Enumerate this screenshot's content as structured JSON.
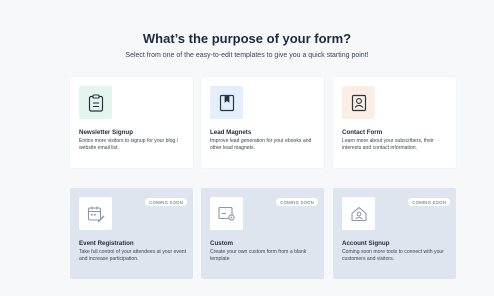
{
  "header": {
    "title": "What’s the purpose of your form?",
    "subtitle": "Select from one of the easy-to-edit templates to give you a quick starting point!"
  },
  "cards": [
    {
      "title": "Newsletter Signup",
      "desc": "Entice more visitors to signup for your blog / website email list.",
      "icon": "clipboard-icon",
      "tile_color": "#e3f5ee"
    },
    {
      "title": "Lead Magnets",
      "desc": "Improve lead generation for your ebooks and other lead magnets.",
      "icon": "book-icon",
      "tile_color": "#e3effb"
    },
    {
      "title": "Contact Form",
      "desc": "Learn more about your subscribers, their interests and contact information.",
      "icon": "contact-icon",
      "tile_color": "#fbeee4"
    },
    {
      "title": "Event Registration",
      "desc": "Take full control of your attendees at your event and increase participation.",
      "icon": "calendar-edit-icon",
      "badge": "COMING SOON"
    },
    {
      "title": "Custom",
      "desc": "Create your own custom form from a blank template",
      "icon": "custom-form-icon",
      "badge": "COMING SOON"
    },
    {
      "title": "Account Signup",
      "desc": "Coming soon more tools to connect with your customers and visitors.",
      "icon": "account-icon",
      "badge": "COMING SOON"
    }
  ],
  "colors": {
    "soon_background": "#dfe5ee",
    "soon_icon": "#8a97a8",
    "active_icon": "#2b3445"
  }
}
